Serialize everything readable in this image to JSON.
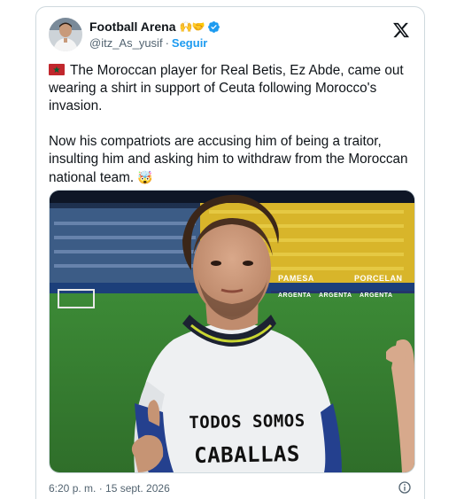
{
  "tweet": {
    "author": {
      "display_name": "Football Arena",
      "name_emojis": "🙌🤝",
      "handle": "@itz_As_yusif",
      "separator": "·",
      "follow_label": "Seguir",
      "verified": true
    },
    "text": {
      "paragraph1": "The Moroccan player for Real Betis, Ez Abde, came out wearing a shirt in support of Ceuta following Morocco's invasion.",
      "paragraph2": "Now his compatriots are accusing him of being a traitor, insulting him and asking him to withdraw from the Moroccan national team.",
      "emoji": "🤯"
    },
    "image": {
      "shirt_line1": "TODOS SOMOS",
      "shirt_line2": "CABALLAS",
      "banner_pamesa": "PAMESA",
      "banner_porcelanosa": "PORCELAN",
      "banner_argenta": "ARGENTA"
    },
    "timestamp": "6:20 p. m. · 15 sept. 2026"
  },
  "colors": {
    "link_blue": "#1d9bf0",
    "secondary_text": "#536471",
    "border": "#cfd9de"
  },
  "icons": [
    "avatar",
    "verified-badge-icon",
    "x-logo-icon",
    "morocco-flag-icon",
    "info-icon"
  ]
}
